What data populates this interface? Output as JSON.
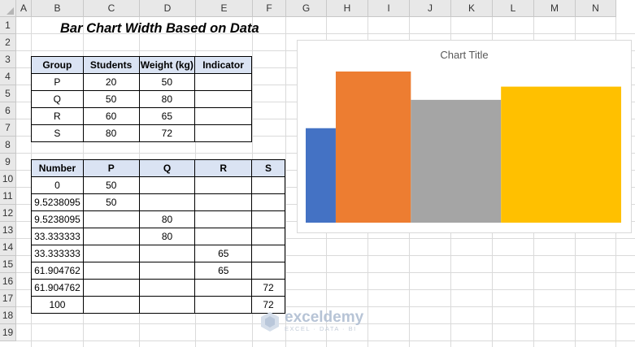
{
  "sheet": {
    "columns": [
      "A",
      "B",
      "C",
      "D",
      "E",
      "F",
      "G",
      "H",
      "I",
      "J",
      "K",
      "L",
      "M",
      "N"
    ],
    "rows": [
      "1",
      "2",
      "3",
      "4",
      "5",
      "6",
      "7",
      "8",
      "9",
      "10",
      "11",
      "12",
      "13",
      "14",
      "15",
      "16",
      "17",
      "18",
      "19"
    ]
  },
  "title": "Bar Chart Width Based on Data",
  "table1": {
    "headers": [
      "Group",
      "Students",
      "Weight (kg)",
      "Indicator"
    ],
    "rows": [
      [
        "P",
        "20",
        "50",
        ""
      ],
      [
        "Q",
        "50",
        "80",
        ""
      ],
      [
        "R",
        "60",
        "65",
        ""
      ],
      [
        "S",
        "80",
        "72",
        ""
      ]
    ]
  },
  "table2": {
    "headers": [
      "Number",
      "P",
      "Q",
      "R",
      "S"
    ],
    "rows": [
      [
        "0",
        "50",
        "",
        "",
        ""
      ],
      [
        "9.5238095",
        "50",
        "",
        "",
        ""
      ],
      [
        "9.5238095",
        "",
        "80",
        "",
        ""
      ],
      [
        "33.333333",
        "",
        "80",
        "",
        ""
      ],
      [
        "33.333333",
        "",
        "",
        "65",
        ""
      ],
      [
        "61.904762",
        "",
        "",
        "65",
        ""
      ],
      [
        "61.904762",
        "",
        "",
        "",
        "72"
      ],
      [
        "100",
        "",
        "",
        "",
        "72"
      ]
    ]
  },
  "chart_data": {
    "type": "area",
    "title": "Chart Title",
    "xlim": [
      0,
      100
    ],
    "ylim": [
      0,
      80
    ],
    "grid": false,
    "series": [
      {
        "name": "P",
        "x": [
          0,
          9.5238095
        ],
        "values": [
          50,
          50
        ],
        "color": "#4472c4"
      },
      {
        "name": "Q",
        "x": [
          9.5238095,
          33.333333
        ],
        "values": [
          80,
          80
        ],
        "color": "#ed7d31"
      },
      {
        "name": "R",
        "x": [
          33.333333,
          61.904762
        ],
        "values": [
          65,
          65
        ],
        "color": "#a5a5a5"
      },
      {
        "name": "S",
        "x": [
          61.904762,
          100
        ],
        "values": [
          72,
          72
        ],
        "color": "#ffc000"
      }
    ]
  },
  "watermark": {
    "name": "exceldemy",
    "tagline": "EXCEL · DATA · BI"
  }
}
